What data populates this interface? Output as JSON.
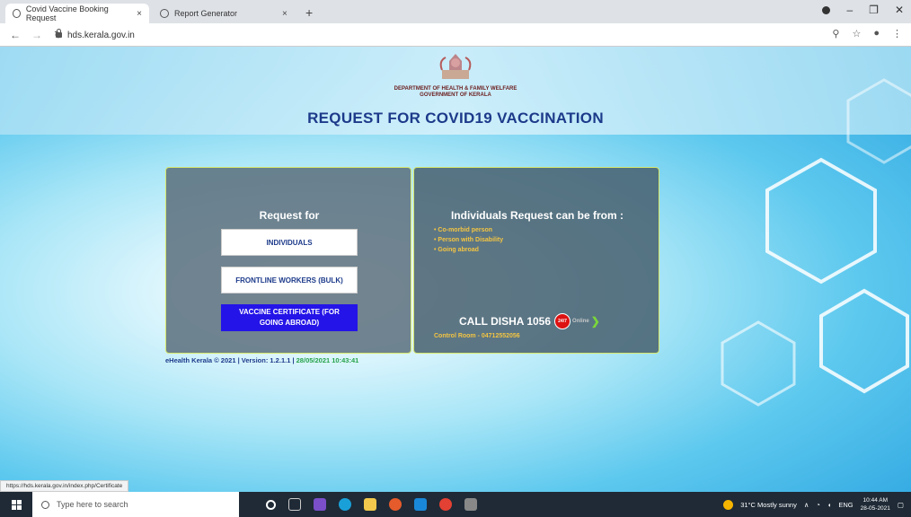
{
  "browser": {
    "tabs": [
      {
        "label": "Covid Vaccine Booking Request",
        "close": "×",
        "active": true
      },
      {
        "label": "Report Generator",
        "close": "×",
        "active": false
      }
    ],
    "new_tab": "+",
    "url": "hds.kerala.gov.in",
    "status_url": "https://hds.kerala.gov.in/index.php/Certificate"
  },
  "header": {
    "dept_line1": "DEPARTMENT OF HEALTH & FAMILY WELFARE",
    "dept_line2": "GOVERNMENT OF KERALA",
    "title": "REQUEST FOR COVID19 VACCINATION"
  },
  "request_panel": {
    "heading": "Request for",
    "buttons": [
      {
        "label": "INDIVIDUALS"
      },
      {
        "label": "FRONTLINE WORKERS (BULK)"
      },
      {
        "label": "VACCINE CERTIFICATE (FOR GOING ABROAD)"
      }
    ]
  },
  "info_panel": {
    "heading": "Individuals Request can be from :",
    "items": [
      "Co-morbid person",
      "Person with Disability",
      "Going abroad"
    ],
    "disha": "CALL DISHA 1056",
    "disha_badge": "24/7",
    "disha_online": "Online",
    "control_room": "Control Room - 04712552056"
  },
  "footer": {
    "copyright": "eHealth Kerala © 2021 | Version: 1.2.1.1 | ",
    "datetime": "28/05/2021 10:43:41"
  },
  "taskbar": {
    "search_placeholder": "Type here to search",
    "weather": "31°C  Mostly sunny",
    "lang": "ENG",
    "time": "10:44 AM",
    "date": "28-05-2021"
  },
  "colors": {
    "title": "#1c3a8a",
    "abroad_button": "#2414e8",
    "list_text": "#f4c542",
    "panel_border": "#d7e86c"
  }
}
